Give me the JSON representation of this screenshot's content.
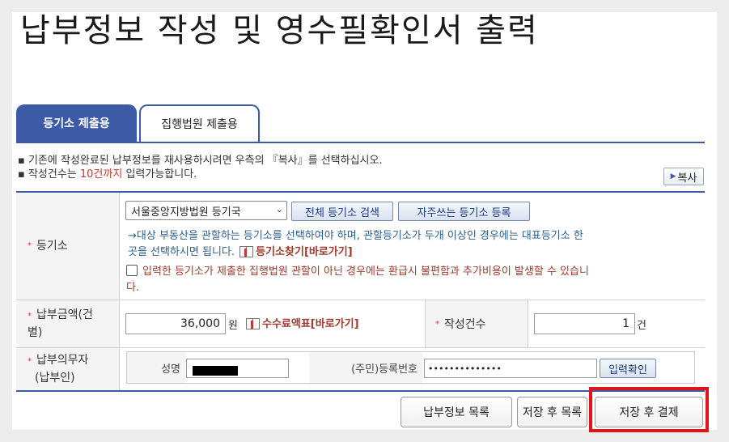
{
  "title": "납부정보 작성 및 영수필확인서 출력",
  "tabs": [
    {
      "label": "등기소 제출용",
      "active": true
    },
    {
      "label": "집행법원 제출용",
      "active": false
    }
  ],
  "notes": {
    "line1": "기존에 작성완료된 납부정보를 재사용하시려면 우측의 『복사』를 선택하십시오.",
    "line2_prefix": "작성건수는 ",
    "line2_highlight": "10건까지",
    "line2_suffix": " 입력가능합니다.",
    "copy_button": "복사"
  },
  "registry": {
    "label": "등기소",
    "selected_office": "서울중앙지방법원 등기국",
    "search_all_button": "전체 등기소 검색",
    "frequent_register_button": "자주쓰는 등기소 등록",
    "info_line1": "→대상 부동산을 관할하는 등기소를 선택하여야 하며, 관할등기소가 두개 이상인 경우에는 대표등기소 한",
    "info_line2": "곳을 선택하시면 됩니다.",
    "find_link": "등기소찾기[바로가기]",
    "warning_line1": "입력한 등기소가 제출한 집행법원 관할이 아닌 경우에는 환급시 불편함과 추가비용이 발생할 수 있습니",
    "warning_line2": "다."
  },
  "amount": {
    "label_line1": "납부금액(건",
    "label_line2": "별)",
    "value": "36,000",
    "unit": "원",
    "fee_link": "수수료액표[바로가기]",
    "count_label": "작성건수",
    "count_value": "1",
    "count_unit": "건"
  },
  "payer": {
    "label_line1": "납부의무자",
    "label_line2": "(납부인)",
    "name_label": "성명",
    "id_label": "(주민)등록번호",
    "id_value": "••••••••••••••",
    "confirm_button": "입력확인"
  },
  "actions": {
    "list": "납부정보 목록",
    "save_list": "저장 후 목록",
    "save_pay": "저장 후 결제"
  },
  "colors": {
    "accent": "#3d5aa6",
    "highlight": "#e0141b",
    "warning": "#a0392b",
    "info": "#2b5f8e"
  }
}
